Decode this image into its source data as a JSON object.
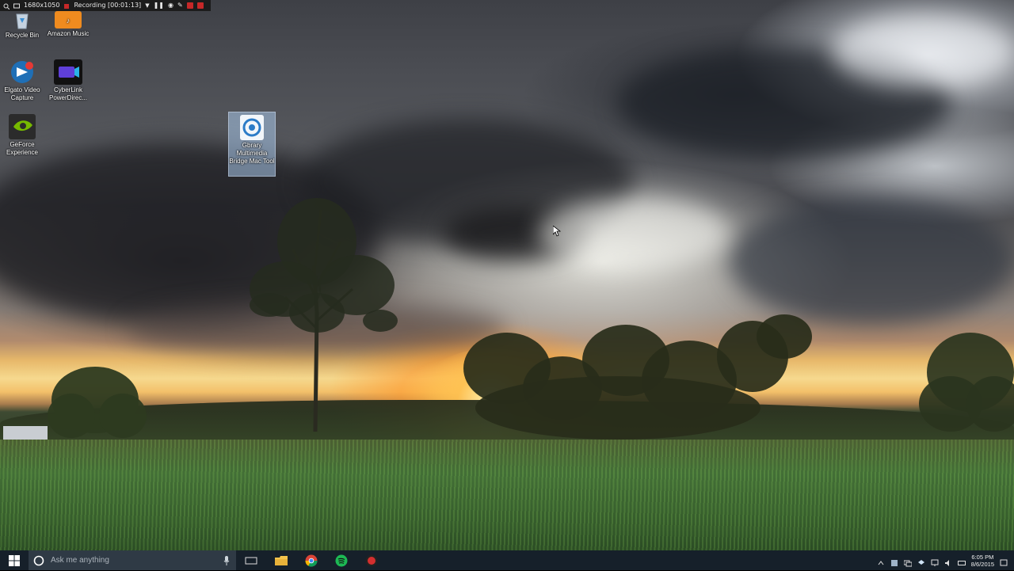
{
  "recording_bar": {
    "resolution": "1680x1050",
    "status": "Recording [00:01:13]"
  },
  "desktop_icons": [
    {
      "label": "Recycle Bin",
      "icon": "recycle-bin-icon"
    },
    {
      "label": "Amazon Music",
      "icon": "amazon-music-icon"
    },
    {
      "label": "Elgato Video Capture",
      "icon": "elgato-icon"
    },
    {
      "label": "CyberLink PowerDirec...",
      "icon": "powerdirector-icon"
    },
    {
      "label": "GeForce Experience",
      "icon": "geforce-icon"
    },
    {
      "label": "Gbrary Multimedia Bridge Mac Tool",
      "icon": "bridge-tool-icon"
    }
  ],
  "taskbar": {
    "search_placeholder": "Ask me anything",
    "apps": [
      "task-view-icon",
      "file-explorer-icon",
      "chrome-icon",
      "spotify-icon",
      "record-app-icon"
    ],
    "clock_time": "6:05 PM",
    "clock_date": "8/6/2015"
  },
  "colors": {
    "taskbar": "#16202a",
    "search_box": "#2f3a45",
    "accent": "#0078d7"
  }
}
